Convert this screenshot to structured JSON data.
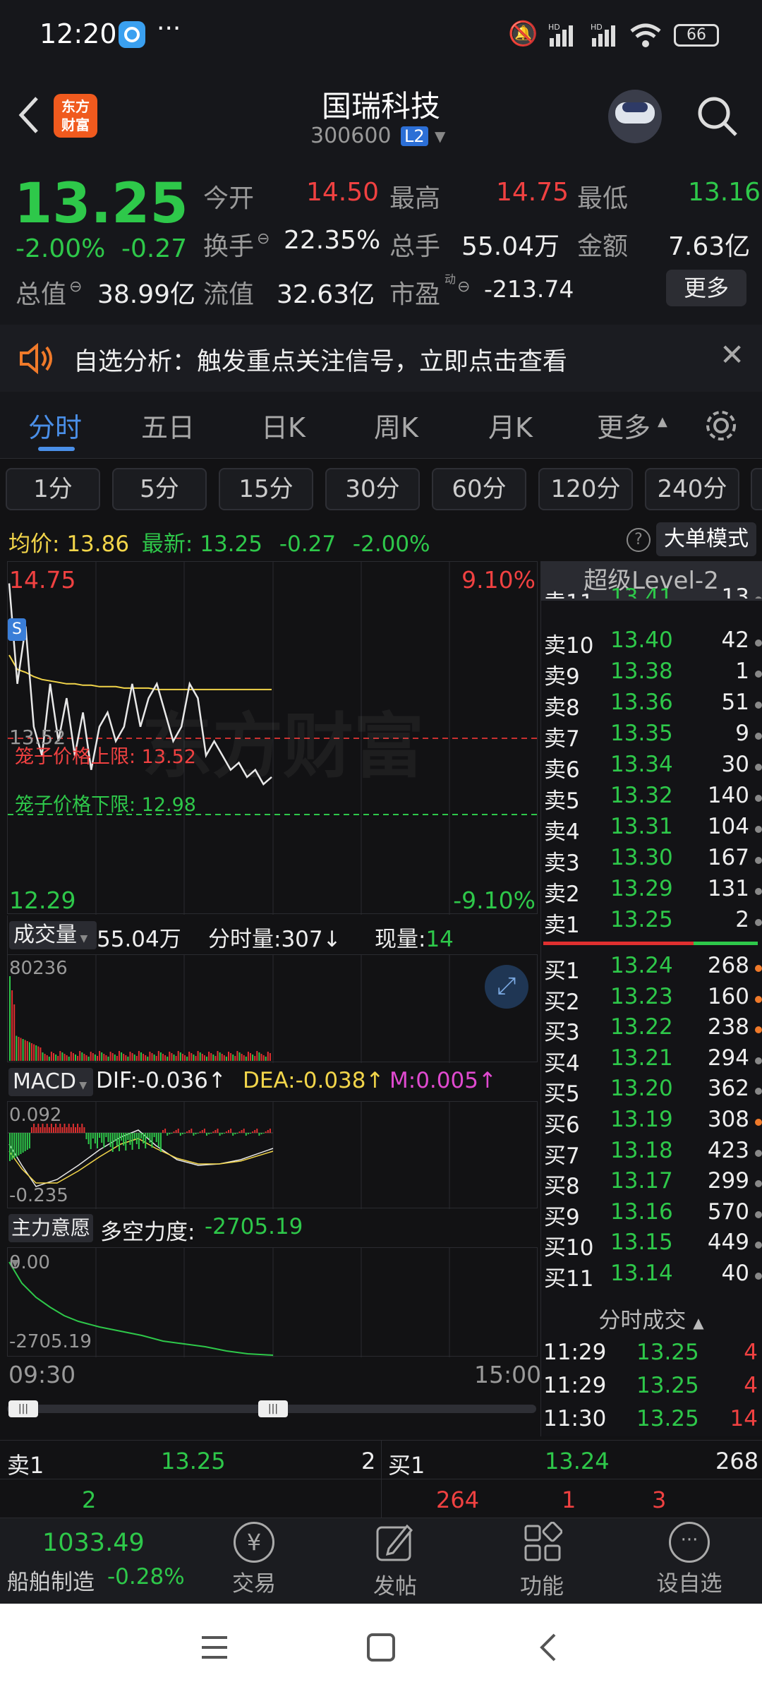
{
  "status": {
    "time": "12:20",
    "battery": "66"
  },
  "header": {
    "title": "国瑞科技",
    "code": "300600",
    "badge": "L2"
  },
  "quote": {
    "price": "13.25",
    "change_pct": "-2.00%",
    "change": "-0.27",
    "open_label": "今开",
    "open": "14.50",
    "high_label": "最高",
    "high": "14.75",
    "low_label": "最低",
    "low": "13.16",
    "turnover_label": "换手",
    "turnover": "22.35%",
    "volume_label": "总手",
    "volume": "55.04万",
    "amount_label": "金额",
    "amount": "7.63亿",
    "mcap_label": "总值",
    "mcap": "38.99亿",
    "float_label": "流值",
    "float": "32.63亿",
    "pe_label": "市盈",
    "pe_sup": "动",
    "pe": "-213.74",
    "more": "更多"
  },
  "notice": {
    "text": "自选分析：触发重点关注信号，立即点击查看"
  },
  "tabs": [
    "分时",
    "五日",
    "日K",
    "周K",
    "月K",
    "更多"
  ],
  "periods": [
    "1分",
    "5分",
    "15分",
    "30分",
    "60分",
    "120分",
    "240分"
  ],
  "infobar": {
    "avg_label": "均价:",
    "avg": "13.86",
    "last_label": "最新:",
    "last": "13.25",
    "chg": "-0.27",
    "pct": "-2.00%",
    "mode": "大单模式"
  },
  "chart": {
    "ymax": "14.75",
    "ymin": "12.29",
    "pmax": "9.10%",
    "pmin": "-9.10%",
    "mid": "13.52",
    "upper_label": "笼子价格上限: 13.52",
    "lower_label": "笼子价格下限: 12.98",
    "watermark": "东方财富",
    "time_start": "09:30",
    "time_end": "15:00"
  },
  "chart_data": {
    "type": "line",
    "title": "",
    "ylim": [
      12.29,
      14.75
    ],
    "series": [
      {
        "name": "",
        "values": [
          14.6,
          13.9,
          14.3,
          13.6,
          13.4,
          13.9,
          13.5,
          13.8,
          13.4,
          13.7,
          13.3,
          13.6,
          13.7,
          13.5,
          13.6,
          13.9,
          13.6,
          13.8,
          13.9,
          13.7,
          13.5,
          13.6,
          13.9,
          13.8,
          13.4,
          13.5,
          13.4,
          13.3,
          13.35,
          13.25,
          13.3,
          13.2,
          13.25
        ]
      },
      {
        "name": "",
        "values": [
          14.1,
          14.0,
          13.98,
          13.95,
          13.93,
          13.92,
          13.91,
          13.9,
          13.9,
          13.89,
          13.89,
          13.88,
          13.88,
          13.88,
          13.87,
          13.87,
          13.87,
          13.87,
          13.86,
          13.86,
          13.86,
          13.86,
          13.86,
          13.86,
          13.86,
          13.86,
          13.86,
          13.86,
          13.86,
          13.86,
          13.86,
          13.86,
          13.86
        ]
      }
    ]
  },
  "volume": {
    "label": "成交量",
    "total": "55.04万",
    "tick_label": "分时量:",
    "tick": "307",
    "arrow": "↓",
    "now_label": "现量:",
    "now": "14",
    "max": "80236"
  },
  "macd": {
    "label": "MACD",
    "dif": "DIF:-0.036",
    "dea": "DEA:-0.038",
    "m": "M:0.005",
    "up": "↑",
    "top": "0.092",
    "bottom": "-0.235"
  },
  "main": {
    "label": "主力意愿",
    "title": "多空力度:",
    "value": "-2705.19",
    "top": "0.00",
    "bottom": "-2705.19"
  },
  "orderbook": {
    "title": "超级Level-2",
    "asks": [
      {
        "label": "卖11",
        "price": "13.41",
        "vol": "13"
      },
      {
        "label": "卖10",
        "price": "13.40",
        "vol": "42"
      },
      {
        "label": "卖9",
        "price": "13.38",
        "vol": "1"
      },
      {
        "label": "卖8",
        "price": "13.36",
        "vol": "51"
      },
      {
        "label": "卖7",
        "price": "13.35",
        "vol": "9"
      },
      {
        "label": "卖6",
        "price": "13.34",
        "vol": "30"
      },
      {
        "label": "卖5",
        "price": "13.32",
        "vol": "140"
      },
      {
        "label": "卖4",
        "price": "13.31",
        "vol": "104"
      },
      {
        "label": "卖3",
        "price": "13.30",
        "vol": "167"
      },
      {
        "label": "卖2",
        "price": "13.29",
        "vol": "131"
      },
      {
        "label": "卖1",
        "price": "13.25",
        "vol": "2"
      }
    ],
    "bids": [
      {
        "label": "买1",
        "price": "13.24",
        "vol": "268",
        "dot": "orange"
      },
      {
        "label": "买2",
        "price": "13.23",
        "vol": "160",
        "dot": "orange"
      },
      {
        "label": "买3",
        "price": "13.22",
        "vol": "238",
        "dot": "orange"
      },
      {
        "label": "买4",
        "price": "13.21",
        "vol": "294",
        "dot": "gray"
      },
      {
        "label": "买5",
        "price": "13.20",
        "vol": "362",
        "dot": "gray"
      },
      {
        "label": "买6",
        "price": "13.19",
        "vol": "308",
        "dot": "orange"
      },
      {
        "label": "买7",
        "price": "13.18",
        "vol": "423",
        "dot": "gray"
      },
      {
        "label": "买8",
        "price": "13.17",
        "vol": "299",
        "dot": "gray"
      },
      {
        "label": "买9",
        "price": "13.16",
        "vol": "570",
        "dot": "gray"
      },
      {
        "label": "买10",
        "price": "13.15",
        "vol": "449",
        "dot": "gray"
      },
      {
        "label": "买11",
        "price": "13.14",
        "vol": "40",
        "dot": "gray"
      }
    ],
    "ticks_title": "分时成交",
    "ticks": [
      {
        "time": "11:29",
        "price": "13.25",
        "vol": "4"
      },
      {
        "time": "11:29",
        "price": "13.25",
        "vol": "4"
      },
      {
        "time": "11:30",
        "price": "13.25",
        "vol": "14"
      }
    ]
  },
  "bottomquote": {
    "s1_label": "卖1",
    "s1_price": "13.25",
    "s1_vol": "2",
    "b1_label": "买1",
    "b1_price": "13.24",
    "b1_vol": "268",
    "left": "2",
    "r1": "264",
    "r2": "1",
    "r3": "3"
  },
  "nav": {
    "index_value": "1033.49",
    "index_name": "船舶制造",
    "index_pct": "-0.28%",
    "trade": "交易",
    "post": "发帖",
    "func": "功能",
    "fav": "设自选"
  }
}
